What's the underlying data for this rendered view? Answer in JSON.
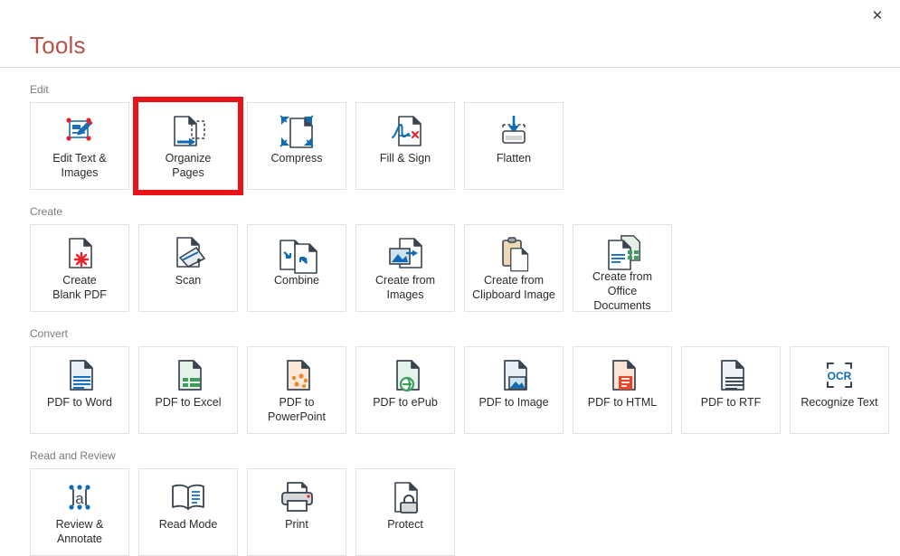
{
  "window": {
    "title": "Tools",
    "close_label": "✕",
    "close_icon": "close-icon"
  },
  "highlighted_tool": "Organize Pages",
  "highlight_color": "#e8141a",
  "title_color": "#b5534a",
  "sections": [
    {
      "label": "Edit",
      "tiles": [
        {
          "label": "Edit Text &\nImages",
          "icon": "edit-text-images-icon"
        },
        {
          "label": "Organize\nPages",
          "icon": "organize-pages-icon",
          "highlighted": true
        },
        {
          "label": "Compress",
          "icon": "compress-icon"
        },
        {
          "label": "Fill & Sign",
          "icon": "fill-and-sign-icon"
        },
        {
          "label": "Flatten",
          "icon": "flatten-icon"
        }
      ]
    },
    {
      "label": "Create",
      "tiles": [
        {
          "label": "Create\nBlank PDF",
          "icon": "create-blank-pdf-icon"
        },
        {
          "label": "Scan",
          "icon": "scan-icon"
        },
        {
          "label": "Combine",
          "icon": "combine-icon"
        },
        {
          "label": "Create from\nImages",
          "icon": "create-from-images-icon"
        },
        {
          "label": "Create from\nClipboard Image",
          "icon": "create-from-clipboard-image-icon"
        },
        {
          "label": "Create from\nOffice\nDocuments",
          "icon": "create-from-office-documents-icon"
        }
      ]
    },
    {
      "label": "Convert",
      "tiles": [
        {
          "label": "PDF to Word",
          "icon": "pdf-to-word-icon"
        },
        {
          "label": "PDF to Excel",
          "icon": "pdf-to-excel-icon"
        },
        {
          "label": "PDF to\nPowerPoint",
          "icon": "pdf-to-powerpoint-icon"
        },
        {
          "label": "PDF to ePub",
          "icon": "pdf-to-epub-icon"
        },
        {
          "label": "PDF to Image",
          "icon": "pdf-to-image-icon"
        },
        {
          "label": "PDF to HTML",
          "icon": "pdf-to-html-icon"
        },
        {
          "label": "PDF to RTF",
          "icon": "pdf-to-rtf-icon"
        },
        {
          "label": "Recognize Text",
          "icon": "recognize-text-icon"
        }
      ]
    },
    {
      "label": "Read and Review",
      "tiles": [
        {
          "label": "Review &\nAnnotate",
          "icon": "review-and-annotate-icon"
        },
        {
          "label": "Read Mode",
          "icon": "read-mode-icon"
        },
        {
          "label": "Print",
          "icon": "print-icon"
        },
        {
          "label": "Protect",
          "icon": "protect-icon"
        }
      ]
    }
  ]
}
